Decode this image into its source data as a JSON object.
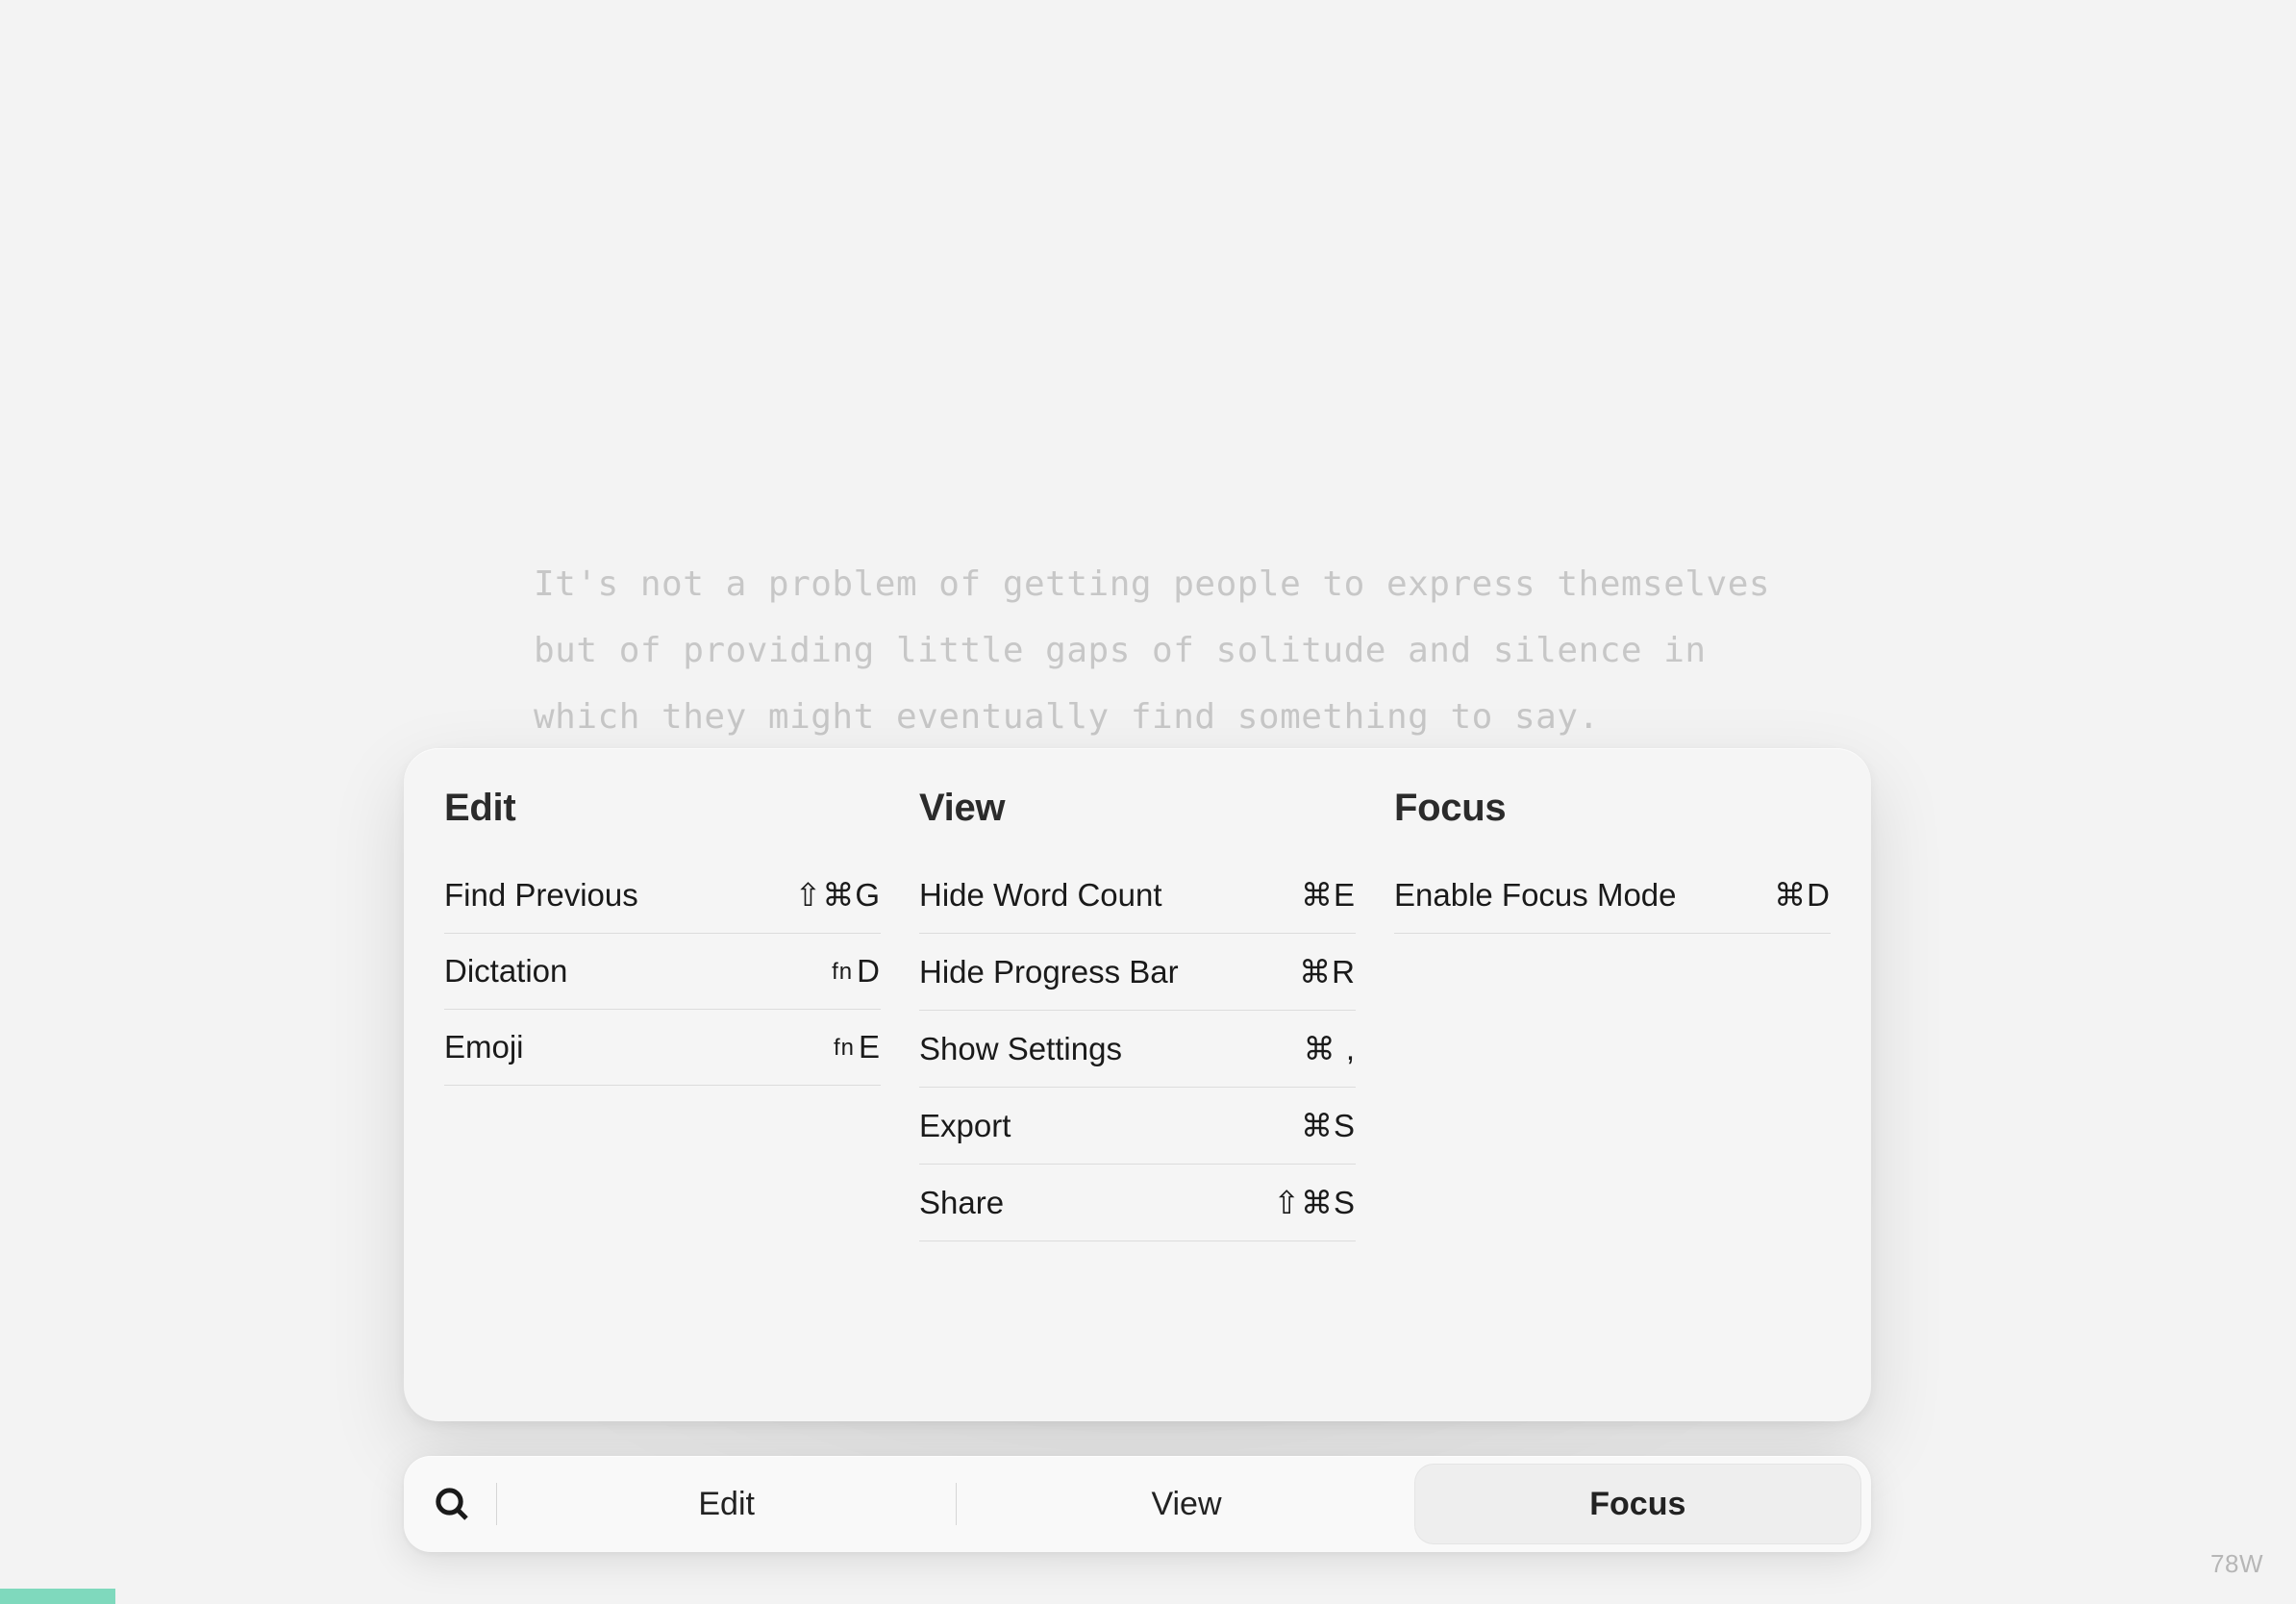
{
  "document": {
    "visible_text": "It's not a problem of getting people to express themselves but of providing little gaps of solitude and silence in which they might eventually find something to say."
  },
  "panel": {
    "columns": [
      {
        "title": "Edit",
        "items": [
          {
            "label": "Find Previous",
            "shortcut": "⇧⌘G"
          },
          {
            "label": "Dictation",
            "shortcut": "fn D"
          },
          {
            "label": "Emoji",
            "shortcut": "fn E"
          }
        ]
      },
      {
        "title": "View",
        "items": [
          {
            "label": "Hide Word Count",
            "shortcut": "⌘E"
          },
          {
            "label": "Hide Progress Bar",
            "shortcut": "⌘R"
          },
          {
            "label": "Show Settings",
            "shortcut": "⌘ ,"
          },
          {
            "label": "Export",
            "shortcut": "⌘S"
          },
          {
            "label": "Share",
            "shortcut": "⇧⌘S"
          }
        ]
      },
      {
        "title": "Focus",
        "items": [
          {
            "label": "Enable Focus Mode",
            "shortcut": "⌘D"
          }
        ]
      }
    ]
  },
  "tabbar": {
    "tabs": [
      {
        "label": "Edit",
        "active": false
      },
      {
        "label": "View",
        "active": false
      },
      {
        "label": "Focus",
        "active": true
      }
    ]
  },
  "status": {
    "word_count": "78W"
  },
  "colors": {
    "background": "#f3f3f3",
    "progress": "#7fd9bd",
    "muted_text": "#c7c7c7"
  }
}
